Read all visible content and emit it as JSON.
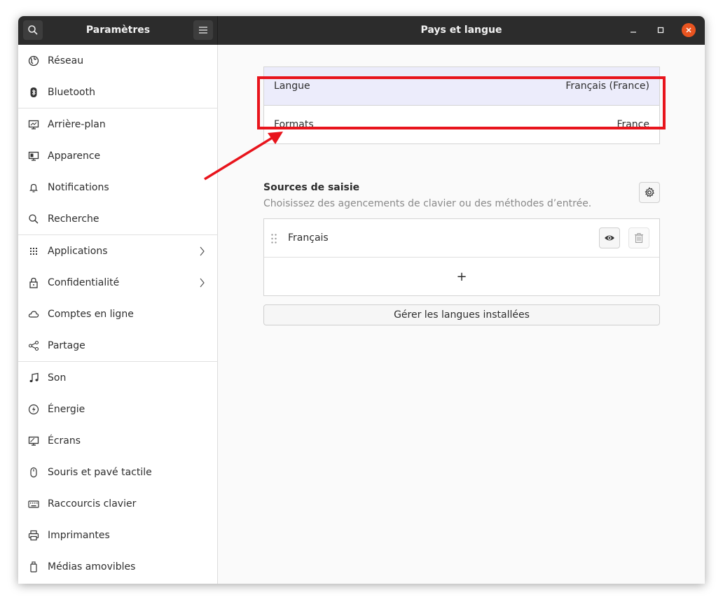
{
  "titlebar": {
    "sidebar_title": "Paramètres",
    "main_title": "Pays et langue"
  },
  "sidebar": {
    "items": [
      {
        "label": "Réseau",
        "icon": "network-icon"
      },
      {
        "label": "Bluetooth",
        "icon": "bluetooth-icon"
      },
      {
        "label": "Arrière-plan",
        "icon": "background-icon"
      },
      {
        "label": "Apparence",
        "icon": "appearance-icon"
      },
      {
        "label": "Notifications",
        "icon": "bell-icon"
      },
      {
        "label": "Recherche",
        "icon": "search-icon"
      },
      {
        "label": "Applications",
        "icon": "apps-grid-icon",
        "has_submenu": true
      },
      {
        "label": "Confidentialité",
        "icon": "lock-icon",
        "has_submenu": true
      },
      {
        "label": "Comptes en ligne",
        "icon": "cloud-icon"
      },
      {
        "label": "Partage",
        "icon": "share-icon"
      },
      {
        "label": "Son",
        "icon": "music-note-icon"
      },
      {
        "label": "Énergie",
        "icon": "power-icon"
      },
      {
        "label": "Écrans",
        "icon": "display-icon"
      },
      {
        "label": "Souris et pavé tactile",
        "icon": "mouse-icon"
      },
      {
        "label": "Raccourcis clavier",
        "icon": "keyboard-icon"
      },
      {
        "label": "Imprimantes",
        "icon": "printer-icon"
      },
      {
        "label": "Médias amovibles",
        "icon": "usb-drive-icon"
      }
    ]
  },
  "language": {
    "langue_label": "Langue",
    "langue_value": "Français (France)",
    "formats_label": "Formats",
    "formats_value": "France"
  },
  "input_sources": {
    "title": "Sources de saisie",
    "subtitle": "Choisissez des agencements de clavier ou des méthodes d’entrée.",
    "sources": [
      {
        "label": "Français"
      }
    ],
    "add_symbol": "+",
    "manage_button": "Gérer les langues installées"
  },
  "colors": {
    "highlight": "#e8141c",
    "close_button": "#e95420",
    "selected_row": "#ececfb"
  }
}
